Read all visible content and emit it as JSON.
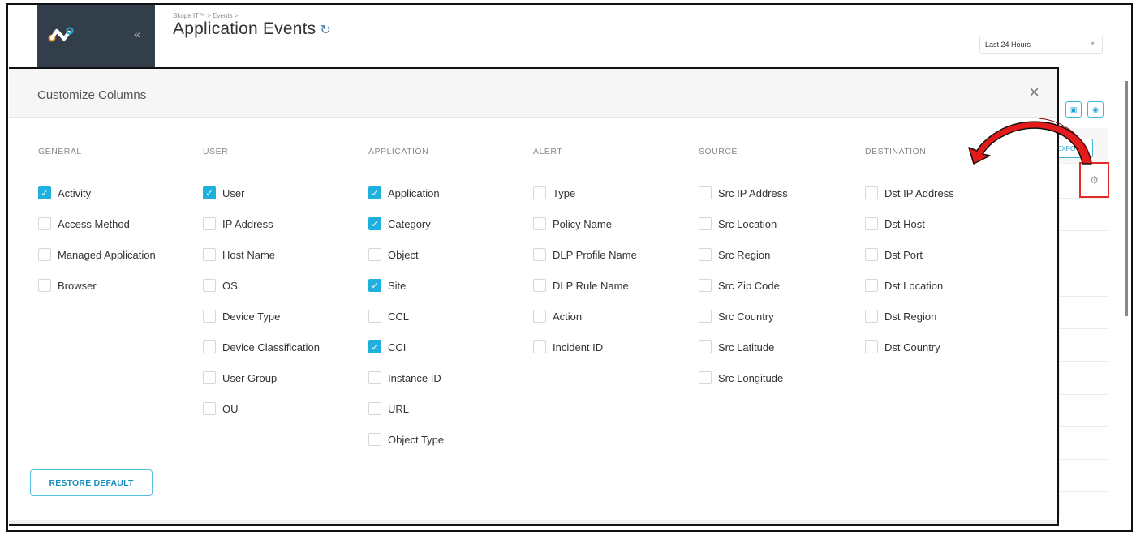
{
  "app": {
    "breadcrumb": "Skope IT™ > Events >",
    "title": "Application Events",
    "collapse_icon": "«",
    "refresh_icon": "↻",
    "time_range": "Last 24 Hours",
    "export_label": "EXPO",
    "gear_icon": "⚙",
    "save_icon": "▣",
    "view_icon": "◉",
    "brand_colors": {
      "sidebar": "#323f4b",
      "logo_orange": "#f28a1e",
      "logo_blue": "#1fa2cf"
    }
  },
  "modal": {
    "title": "Customize Columns",
    "close_icon": "×",
    "restore_label": "RESTORE DEFAULT",
    "accent_color": "#1fb1dd",
    "groups": [
      {
        "title": "GENERAL",
        "options": [
          {
            "label": "Activity",
            "checked": true
          },
          {
            "label": "Access Method",
            "checked": false
          },
          {
            "label": "Managed Application",
            "checked": false
          },
          {
            "label": "Browser",
            "checked": false
          }
        ]
      },
      {
        "title": "USER",
        "options": [
          {
            "label": "User",
            "checked": true
          },
          {
            "label": "IP Address",
            "checked": false
          },
          {
            "label": "Host Name",
            "checked": false
          },
          {
            "label": "OS",
            "checked": false
          },
          {
            "label": "Device Type",
            "checked": false
          },
          {
            "label": "Device Classification",
            "checked": false
          },
          {
            "label": "User Group",
            "checked": false
          },
          {
            "label": "OU",
            "checked": false
          }
        ]
      },
      {
        "title": "APPLICATION",
        "options": [
          {
            "label": "Application",
            "checked": true
          },
          {
            "label": "Category",
            "checked": true
          },
          {
            "label": "Object",
            "checked": false
          },
          {
            "label": "Site",
            "checked": true
          },
          {
            "label": "CCL",
            "checked": false
          },
          {
            "label": "CCI",
            "checked": true
          },
          {
            "label": "Instance ID",
            "checked": false
          },
          {
            "label": "URL",
            "checked": false
          },
          {
            "label": "Object Type",
            "checked": false
          }
        ]
      },
      {
        "title": "ALERT",
        "options": [
          {
            "label": "Type",
            "checked": false
          },
          {
            "label": "Policy Name",
            "checked": false
          },
          {
            "label": "DLP Profile Name",
            "checked": false
          },
          {
            "label": "DLP Rule Name",
            "checked": false
          },
          {
            "label": "Action",
            "checked": false
          },
          {
            "label": "Incident ID",
            "checked": false
          }
        ]
      },
      {
        "title": "SOURCE",
        "options": [
          {
            "label": "Src IP Address",
            "checked": false
          },
          {
            "label": "Src Location",
            "checked": false
          },
          {
            "label": "Src Region",
            "checked": false
          },
          {
            "label": "Src Zip Code",
            "checked": false
          },
          {
            "label": "Src Country",
            "checked": false
          },
          {
            "label": "Src Latitude",
            "checked": false
          },
          {
            "label": "Src Longitude",
            "checked": false
          }
        ]
      },
      {
        "title": "DESTINATION",
        "options": [
          {
            "label": "Dst IP Address",
            "checked": false
          },
          {
            "label": "Dst Host",
            "checked": false
          },
          {
            "label": "Dst Port",
            "checked": false
          },
          {
            "label": "Dst Location",
            "checked": false
          },
          {
            "label": "Dst Region",
            "checked": false
          },
          {
            "label": "Dst Country",
            "checked": false
          }
        ]
      }
    ]
  }
}
